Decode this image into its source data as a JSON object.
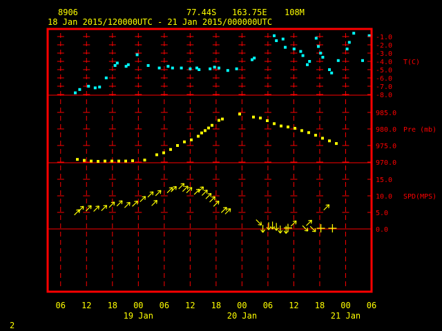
{
  "header": {
    "station": "8906",
    "lat": "77.44S",
    "lon": "163.75E",
    "elevation": "108M",
    "period": "18 Jan 2015/120000UTC - 21 Jan 2015/000000UTC"
  },
  "page_number": "2",
  "colors": {
    "background": "#000000",
    "frame": "#ff0000",
    "grid": "#ff0000",
    "header_text": "#ffff00",
    "axis_labels": "#ff0000",
    "temperature": "#00ffff",
    "pressure": "#ffff00",
    "wind": "#ffff00"
  },
  "x_axis": {
    "tick_labels": [
      "06",
      "12",
      "18",
      "00",
      "06",
      "12",
      "18",
      "00",
      "06",
      "12",
      "18",
      "00",
      "06"
    ],
    "tick_hours": [
      -6,
      0,
      6,
      12,
      18,
      24,
      30,
      36,
      42,
      48,
      54,
      60,
      66
    ],
    "date_labels": [
      {
        "hour": 12,
        "text": "19 Jan"
      },
      {
        "hour": 36,
        "text": "20 Jan"
      },
      {
        "hour": 60,
        "text": "21 Jan"
      }
    ],
    "range_hours": [
      -9,
      66
    ]
  },
  "chart_data": [
    {
      "type": "scatter",
      "ylabel": "T(C)",
      "color": "#00ffff",
      "ylim": [
        -8.0,
        -0.5
      ],
      "yticks": [
        "-1.0",
        "-2.0",
        "-3.0",
        "-4.0",
        "-5.0",
        "-6.0",
        "-7.0",
        "-8.0"
      ],
      "x_unit": "hours since 19 Jan 2015 00:00 UTC",
      "points": [
        [
          0,
          -7.8
        ],
        [
          1,
          -7.4
        ],
        [
          3,
          -7.0
        ],
        [
          4.5,
          -7.2
        ],
        [
          5.5,
          -7.1
        ],
        [
          7,
          -6.0
        ],
        [
          9,
          -4.5
        ],
        [
          9.5,
          -4.2
        ],
        [
          11.5,
          -4.6
        ],
        [
          12,
          -4.4
        ],
        [
          14,
          -3.2
        ],
        [
          16.5,
          -4.5
        ],
        [
          19,
          -4.8
        ],
        [
          21,
          -4.6
        ],
        [
          22,
          -4.8
        ],
        [
          24,
          -4.8
        ],
        [
          26,
          -4.9
        ],
        [
          27.5,
          -4.8
        ],
        [
          28,
          -5.0
        ],
        [
          30.5,
          -4.9
        ],
        [
          31.5,
          -4.7
        ],
        [
          32.5,
          -4.8
        ],
        [
          34.5,
          -5.1
        ],
        [
          36.5,
          -4.9
        ],
        [
          40,
          -3.8
        ],
        [
          40.5,
          -3.6
        ],
        [
          45,
          -0.9
        ],
        [
          45.5,
          -1.5
        ],
        [
          47,
          -1.3
        ],
        [
          47.5,
          -2.3
        ],
        [
          49.5,
          -2.5
        ],
        [
          51,
          -2.8
        ],
        [
          51.5,
          -3.3
        ],
        [
          52.5,
          -4.4
        ],
        [
          53,
          -4.0
        ],
        [
          54.5,
          -1.2
        ],
        [
          55,
          -2.2
        ],
        [
          55.5,
          -3.0
        ],
        [
          56,
          -3.5
        ],
        [
          57.5,
          -5.0
        ],
        [
          58,
          -5.4
        ],
        [
          59.5,
          -3.9
        ],
        [
          61.5,
          -2.5
        ],
        [
          62,
          -1.7
        ],
        [
          63,
          -0.6
        ],
        [
          65,
          -3.9
        ],
        [
          66.5,
          -0.9
        ]
      ]
    },
    {
      "type": "scatter",
      "ylabel": "Pre (mb)",
      "color": "#ffff00",
      "ylim": [
        970.0,
        985.0
      ],
      "yticks": [
        "985.0",
        "980.0",
        "975.0",
        "970.0"
      ],
      "x_unit": "hours since 19 Jan 2015 00:00 UTC",
      "points": [
        [
          0,
          970.8
        ],
        [
          2,
          970.5
        ],
        [
          4,
          970.3
        ],
        [
          6,
          970.2
        ],
        [
          8,
          970.3
        ],
        [
          10,
          970.3
        ],
        [
          12,
          970.3
        ],
        [
          14,
          970.3
        ],
        [
          16,
          970.4
        ],
        [
          19.5,
          970.6
        ],
        [
          23,
          972.2
        ],
        [
          25,
          972.8
        ],
        [
          27,
          973.8
        ],
        [
          29,
          975.0
        ],
        [
          31,
          976.1
        ],
        [
          33,
          976.7
        ],
        [
          35,
          977.8
        ],
        [
          36,
          978.8
        ],
        [
          37,
          979.5
        ],
        [
          38,
          980.3
        ],
        [
          39,
          981.1
        ],
        [
          41,
          982.6
        ],
        [
          42,
          983.0
        ],
        [
          47,
          984.5
        ],
        [
          51,
          983.6
        ],
        [
          53,
          983.3
        ],
        [
          55,
          982.5
        ],
        [
          57,
          981.6
        ],
        [
          59,
          980.9
        ],
        [
          61,
          980.6
        ],
        [
          63,
          980.2
        ],
        [
          65,
          979.5
        ],
        [
          67,
          978.9
        ],
        [
          69,
          978.1
        ],
        [
          71,
          977.2
        ],
        [
          73,
          976.4
        ],
        [
          75,
          975.6
        ]
      ]
    },
    {
      "type": "scatter",
      "ylabel": "SPD(MPS)",
      "color": "#ffff00",
      "ylim": [
        0.0,
        15.0
      ],
      "yticks": [
        "15.0",
        "10.0",
        "5.0",
        "0.0"
      ],
      "x_unit": "hours since 19 Jan 2015 00:00 UTC",
      "winds": [
        {
          "x": 0,
          "speed": 4.5,
          "toward": "NE"
        },
        {
          "x": 1,
          "speed": 5.5,
          "toward": "NE"
        },
        {
          "x": 3,
          "speed": 5.7,
          "toward": "NE"
        },
        {
          "x": 5,
          "speed": 5.6,
          "toward": "NE"
        },
        {
          "x": 7,
          "speed": 5.8,
          "toward": "NE"
        },
        {
          "x": 9,
          "speed": 6.8,
          "toward": "NE"
        },
        {
          "x": 11,
          "speed": 7.2,
          "toward": "NE"
        },
        {
          "x": 13,
          "speed": 6.7,
          "toward": "NE"
        },
        {
          "x": 15,
          "speed": 7.1,
          "toward": "NE"
        },
        {
          "x": 17,
          "speed": 8.5,
          "toward": "NE"
        },
        {
          "x": 19,
          "speed": 9.9,
          "toward": "NE"
        },
        {
          "x": 20,
          "speed": 7.3,
          "toward": "NE"
        },
        {
          "x": 21,
          "speed": 10.3,
          "toward": "NE"
        },
        {
          "x": 24,
          "speed": 11.2,
          "toward": "NE"
        },
        {
          "x": 25,
          "speed": 11.5,
          "toward": "NE"
        },
        {
          "x": 27,
          "speed": 12.4,
          "toward": "NE"
        },
        {
          "x": 28,
          "speed": 11.6,
          "toward": "NE"
        },
        {
          "x": 29,
          "speed": 11.2,
          "toward": "NE"
        },
        {
          "x": 31,
          "speed": 10.7,
          "toward": "NE"
        },
        {
          "x": 32,
          "speed": 11.4,
          "toward": "NE"
        },
        {
          "x": 33,
          "speed": 10.4,
          "toward": "NE"
        },
        {
          "x": 34,
          "speed": 9.4,
          "toward": "NE"
        },
        {
          "x": 35,
          "speed": 8.4,
          "toward": "NE"
        },
        {
          "x": 36,
          "speed": 7.1,
          "toward": "NE"
        },
        {
          "x": 38,
          "speed": 5.2,
          "toward": "NE"
        },
        {
          "x": 39,
          "speed": 4.8,
          "toward": "NE"
        },
        {
          "x": 47,
          "speed": 2.5,
          "toward": "SE"
        },
        {
          "x": 48.5,
          "speed": 0.8,
          "toward": "S"
        },
        {
          "x": 50,
          "speed": 1.6,
          "toward": "S"
        },
        {
          "x": 51,
          "speed": 1.8,
          "toward": "S"
        },
        {
          "x": 52,
          "speed": 1.4,
          "toward": "S"
        },
        {
          "x": 53,
          "speed": 0.6,
          "toward": "S"
        },
        {
          "x": 54.5,
          "speed": 0.5,
          "toward": "S"
        },
        {
          "x": 55,
          "speed": 0.3,
          "toward": "calm"
        },
        {
          "x": 56,
          "speed": 1.1,
          "toward": "NE"
        },
        {
          "x": 59,
          "speed": 0.7,
          "toward": "SE"
        },
        {
          "x": 60,
          "speed": 1.3,
          "toward": "NE"
        },
        {
          "x": 61,
          "speed": 0.5,
          "toward": "SE"
        },
        {
          "x": 63.5,
          "speed": 0.2,
          "toward": "calm"
        },
        {
          "x": 64.5,
          "speed": 6.0,
          "toward": "NE"
        },
        {
          "x": 66.5,
          "speed": 0.2,
          "toward": "calm"
        }
      ]
    }
  ]
}
